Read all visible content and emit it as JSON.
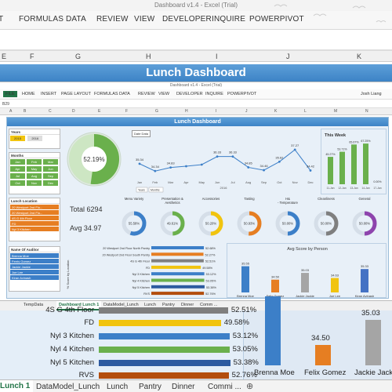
{
  "app": {
    "title": "Dashboard v1.4 - Excel (Trial)",
    "user": "Josh Liang"
  },
  "ribbon": {
    "tabs": [
      "FILE",
      "HOME",
      "INSERT",
      "PAGE LAYOUT",
      "FORMULAS",
      "DATA",
      "REVIEW",
      "VIEW",
      "DEVELOPER",
      "INQUIRE",
      "POWERPIVOT"
    ]
  },
  "outer_ribbon": [
    "T",
    "FORMULAS",
    "DATA",
    "REVIEW",
    "VIEW",
    "DEVELOPER",
    "INQUIRE",
    "POWERPIVOT"
  ],
  "outer_columns": [
    "E",
    "F",
    "G",
    "H",
    "I",
    "J",
    "K"
  ],
  "inner_columns": [
    "A",
    "B",
    "C",
    "D",
    "E",
    "F",
    "G",
    "H",
    "I",
    "J",
    "K",
    "L",
    "M",
    "N"
  ],
  "name_box": "B29",
  "dashboard_title": "Lunch Dashboard",
  "slicers": {
    "years": {
      "title": "Years",
      "items": [
        "2015",
        "2016"
      ]
    },
    "months": {
      "title": "Months",
      "items": [
        "Jan",
        "Feb",
        "Mar",
        "Apr",
        "May",
        "Jun",
        "Jul",
        "Aug",
        "Sep",
        "Oct",
        "Nov",
        "Dec"
      ]
    },
    "location": {
      "title": "Lunch Location",
      "items": [
        "20 Westport 2nd Flo...",
        "20 Westport 2nd Flo...",
        "4S G 4th Floor",
        "FD",
        "Nyl 3 Kitchen"
      ]
    },
    "auditor": {
      "title": "Name Of Auditor",
      "items": [
        "Brenna Moe",
        "Ferris Gomez",
        "Jackie Jackie",
        "Joe Lee",
        "Kiran Avinash"
      ]
    }
  },
  "donut_main": {
    "value": "52.19%"
  },
  "date_button": "Date Data",
  "line_chart": {
    "months": [
      "Jan",
      "Feb",
      "Mar",
      "Apr",
      "May",
      "Jun",
      "Jul",
      "Aug",
      "Sep",
      "Oct",
      "Nov",
      "Dec"
    ],
    "values": [
      35.34,
      34.34,
      34.83,
      35.0,
      35.22,
      36.33,
      36.33,
      34.85,
      34.46,
      35.62,
      37.27,
      34.42
    ],
    "labels": [
      "35.34",
      "34.34",
      "34.83",
      "",
      "",
      "36.33",
      "36.33",
      "34.85",
      "34.46",
      "35.62",
      "37.27",
      "34.42"
    ],
    "year": "2016",
    "buttons": [
      "Years",
      "Months"
    ]
  },
  "this_week": {
    "title": "This Week",
    "bars": [
      {
        "label": "11-Jan",
        "value": 45.27
      },
      {
        "label": "12-Jan",
        "value": 53.71
      },
      {
        "label": "13-Jan",
        "value": 65.67
      },
      {
        "label": "14-Jan",
        "value": 67.25
      },
      {
        "label": "17-Jan",
        "value": 0.0
      }
    ],
    "value_labels": [
      "45.27%",
      "53.71%",
      "65.67%",
      "67.25%",
      "0.00%"
    ]
  },
  "totals": {
    "total": "Total 6294",
    "avg": "Avg 34.97"
  },
  "categories": [
    {
      "name": "Menu Variety",
      "value": "55.58%",
      "color": "#3c7fc8"
    },
    {
      "name": "Presentation & Aesthetics",
      "value": "49.61%",
      "color": "#6ab04c"
    },
    {
      "name": "Accessories",
      "value": "50.20%",
      "color": "#f1c40f"
    },
    {
      "name": "Tasting",
      "value": "50.93%",
      "color": "#e67e22"
    },
    {
      "name": "H&S - Temperature",
      "value": "50.00%",
      "color": "#3c7fc8"
    },
    {
      "name": "Cleanliness",
      "value": "50.00%",
      "color": "#7f7f7f"
    },
    {
      "name": "General",
      "value": "50.00%",
      "color": "#8e44ad"
    }
  ],
  "location_bars": {
    "axis": "% Score by Location",
    "rows": [
      {
        "name": "20 Westport 2nd Floor North Pantry",
        "value": "52.68%",
        "pct": 52.68,
        "color": "#3c7fc8"
      },
      {
        "name": "20 Westport 2nd Floor South Pantry",
        "value": "52.27%",
        "pct": 52.27,
        "color": "#e67e22"
      },
      {
        "name": "4S G 4th Floor",
        "value": "52.51%",
        "pct": 52.51,
        "color": "#7f7f7f"
      },
      {
        "name": "FD",
        "value": "49.58%",
        "pct": 49.58,
        "color": "#f1c40f"
      },
      {
        "name": "Nyl 3 Kitchen",
        "value": "53.12%",
        "pct": 53.12,
        "color": "#3c7fc8"
      },
      {
        "name": "Nyl 4 Kitchen",
        "value": "53.05%",
        "pct": 53.05,
        "color": "#6ab04c"
      },
      {
        "name": "Nyl 5 Kitchen",
        "value": "53.38%",
        "pct": 53.38,
        "color": "#2c5aa0"
      },
      {
        "name": "RVS",
        "value": "52.76%",
        "pct": 52.76,
        "color": "#b34e0e"
      }
    ]
  },
  "person_chart": {
    "title": "Avg Score by Person",
    "bars": [
      {
        "name": "Brenna Moe",
        "value": "35.55",
        "num": 35.55,
        "color": "#3c7fc8"
      },
      {
        "name": "Felix Gomez",
        "value": "34.50",
        "num": 34.5,
        "color": "#e67e22"
      },
      {
        "name": "Jackie Jackie",
        "value": "35.03",
        "num": 35.03,
        "color": "#a5a5a5"
      },
      {
        "name": "Joe Lee",
        "value": "34.63",
        "num": 34.63,
        "color": "#f1c40f"
      },
      {
        "name": "Kiran Avinash",
        "value": "35.33",
        "num": 35.33,
        "color": "#4472c4"
      }
    ]
  },
  "inner_tabs": [
    "TempData",
    "Dashboard Lunch 1",
    "DataModel_Lunch",
    "Lunch",
    "Pantry",
    "Dinner",
    "Comm ..."
  ],
  "big_bars": [
    {
      "name": "4S G 4th Floor",
      "value": "52.51%",
      "pct": 52.51,
      "color": "#7f7f7f"
    },
    {
      "name": "FD",
      "value": "49.58%",
      "pct": 49.58,
      "color": "#f1c40f"
    },
    {
      "name": "Nyl 3 Kitchen",
      "value": "53.12%",
      "pct": 53.12,
      "color": "#3c7fc8"
    },
    {
      "name": "Nyl 4 Kitchen",
      "value": "53.05%",
      "pct": 53.05,
      "color": "#6ab04c"
    },
    {
      "name": "Nyl 5 Kitchen",
      "value": "53.38%",
      "pct": 53.38,
      "color": "#2c5aa0"
    },
    {
      "name": "RVS",
      "value": "52.76%",
      "pct": 52.76,
      "color": "#b34e0e"
    }
  ],
  "big_person": [
    {
      "name": "Brenna Moe",
      "value": "",
      "color": "#3c7fc8"
    },
    {
      "name": "Felix Gomez",
      "value": "34.50",
      "color": "#e67e22"
    },
    {
      "name": "Jackie Jackie",
      "value": "35.03",
      "color": "#a5a5a5"
    }
  ],
  "outer_tabs": [
    "Lunch 1",
    "DataModel_Lunch",
    "Lunch",
    "Pantry",
    "Dinner",
    "Commi ..."
  ]
}
